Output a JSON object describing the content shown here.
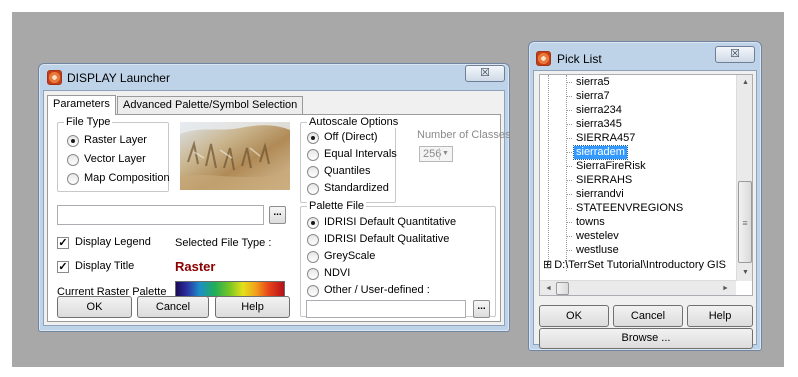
{
  "display_launcher": {
    "title": "DISPLAY Launcher",
    "close_glyph": "☒",
    "tabs": [
      {
        "label": "Parameters"
      },
      {
        "label": "Advanced Palette/Symbol Selection"
      }
    ],
    "file_type": {
      "legend": "File Type",
      "options": [
        {
          "label": "Raster Layer",
          "selected": true
        },
        {
          "label": "Vector Layer",
          "selected": false
        },
        {
          "label": "Map Composition",
          "selected": false
        }
      ]
    },
    "file_input": {
      "value": "",
      "browse_label": "..."
    },
    "display_legend": {
      "label": "Display Legend",
      "checked": true
    },
    "display_title": {
      "label": "Display Title",
      "checked": true
    },
    "check_mark": "✓",
    "selected_file_type_label": "Selected File Type :",
    "selected_file_type_value": "Raster",
    "selected_file_type_color": "#8b0000",
    "current_palette_label": "Current Raster Palette",
    "autoscale": {
      "legend": "Autoscale Options",
      "options": [
        {
          "label": "Off (Direct)",
          "selected": true
        },
        {
          "label": "Equal Intervals",
          "selected": false
        },
        {
          "label": "Quantiles",
          "selected": false
        },
        {
          "label": "Standardized",
          "selected": false
        }
      ],
      "classes_label": "Number of  Classes",
      "classes_value": "256",
      "dropdown_arrow": "▼"
    },
    "palette_file": {
      "legend": "Palette File",
      "options": [
        {
          "label": "IDRISI Default Quantitative",
          "selected": true
        },
        {
          "label": "IDRISI Default Qualitative",
          "selected": false
        },
        {
          "label": "GreyScale",
          "selected": false
        },
        {
          "label": "NDVI",
          "selected": false
        },
        {
          "label": "Other / User-defined :",
          "selected": false
        }
      ],
      "input_value": "",
      "browse_label": "..."
    },
    "buttons": {
      "ok": "OK",
      "cancel": "Cancel",
      "help": "Help"
    }
  },
  "pick_list": {
    "title": "Pick List",
    "close_glyph": "☒",
    "items": [
      {
        "label": "sierra5",
        "selected": false
      },
      {
        "label": "sierra7",
        "selected": false
      },
      {
        "label": "sierra234",
        "selected": false
      },
      {
        "label": "sierra345",
        "selected": false
      },
      {
        "label": "SIERRA457",
        "selected": false
      },
      {
        "label": "sierradem",
        "selected": true
      },
      {
        "label": "SierraFireRisk",
        "selected": false
      },
      {
        "label": "SIERRAHS",
        "selected": false
      },
      {
        "label": "sierrandvi",
        "selected": false
      },
      {
        "label": "STATEENVREGIONS",
        "selected": false
      },
      {
        "label": "towns",
        "selected": false
      },
      {
        "label": "westelev",
        "selected": false
      },
      {
        "label": "westluse",
        "selected": false
      }
    ],
    "folder": {
      "expander": "⊞",
      "label": "D:\\TerrSet Tutorial\\Introductory GIS"
    },
    "scroll_glyphs": {
      "up": "▲",
      "down": "▼",
      "left": "◄",
      "right": "►",
      "grip": "≡"
    },
    "buttons": {
      "ok": "OK",
      "cancel": "Cancel",
      "help": "Help",
      "browse": "Browse ..."
    }
  },
  "colors": {
    "desktop": "#a8a8a8",
    "window_frame": "#bfd3e8",
    "selection": "#3399ff",
    "raster_text": "#8b0000"
  }
}
